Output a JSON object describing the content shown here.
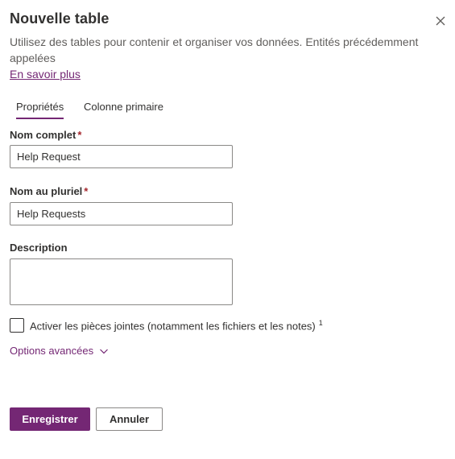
{
  "panel": {
    "title": "Nouvelle table",
    "close_icon": "close-icon",
    "description": "Utilisez des tables pour contenir et organiser vos données. Entités précédemment appelées",
    "learn_more": "En savoir plus"
  },
  "tabs": [
    {
      "label": "Propriétés",
      "selected": true
    },
    {
      "label": "Colonne primaire",
      "selected": false
    }
  ],
  "form": {
    "display_name": {
      "label": "Nom complet",
      "required_mark": "*",
      "value": "Help Request"
    },
    "plural_name": {
      "label": "Nom au pluriel",
      "required_mark": "*",
      "value": "Help Requests"
    },
    "description": {
      "label": "Description",
      "value": ""
    },
    "attachments": {
      "label": "Activer les pièces jointes (notamment les fichiers et les notes)",
      "superscript": "1",
      "checked": false
    },
    "advanced_options": {
      "label": "Options avancées",
      "icon": "chevron-down-icon"
    }
  },
  "actions": {
    "save_label": "Enregistrer",
    "cancel_label": "Annuler"
  },
  "colors": {
    "accent": "#742774",
    "required": "#a4262c",
    "text": "#323130",
    "secondary_text": "#605e5c",
    "border": "#8a8886"
  }
}
